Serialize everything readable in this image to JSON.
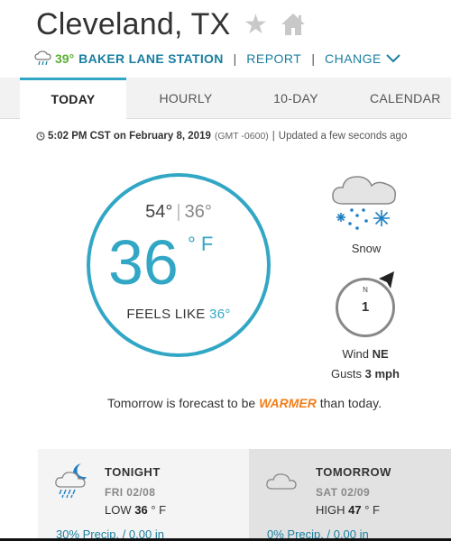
{
  "header": {
    "city": "Cleveland, TX",
    "station_temp": "39°",
    "station_name": "BAKER LANE STATION",
    "report_link": "REPORT",
    "change_link": "CHANGE"
  },
  "tabs": [
    {
      "label": "TODAY",
      "active": true
    },
    {
      "label": "HOURLY",
      "active": false
    },
    {
      "label": "10-DAY",
      "active": false
    },
    {
      "label": "CALENDAR",
      "active": false
    }
  ],
  "timestamp": {
    "time": "5:02 PM CST on February 8, 2019",
    "gmt": "(GMT -0600)",
    "separator": "|",
    "updated": "Updated a few seconds ago"
  },
  "current": {
    "high": "54°",
    "low": "36°",
    "temp": "36",
    "unit": "° F",
    "feels_like_label": "FEELS LIKE",
    "feels_like_value": "36°",
    "condition": "Snow",
    "wind_compass_label": "N",
    "wind_speed": "1",
    "wind_label": "Wind",
    "wind_dir": "NE",
    "gusts_label": "Gusts",
    "gusts_value": "3 mph"
  },
  "forecast_text": {
    "before": "Tomorrow is forecast to be ",
    "highlight": "WARMER",
    "after": " than today."
  },
  "cards": {
    "tonight": {
      "title": "TONIGHT",
      "date": "FRI 02/08",
      "temp_label": "LOW",
      "temp_value": "36",
      "temp_unit": "° F",
      "precip": "30% Precip. / 0.00 in"
    },
    "tomorrow": {
      "title": "TOMORROW",
      "date": "SAT 02/09",
      "temp_label": "HIGH",
      "temp_value": "47",
      "temp_unit": "° F",
      "precip": "0% Precip. / 0.00 in"
    }
  },
  "colors": {
    "accent": "#32a7c5",
    "link": "#1a7fa0",
    "station_temp": "#5ab035",
    "warm": "#f07f1d"
  },
  "icons": [
    "rain-icon",
    "star-icon",
    "home-icon",
    "chevron-down-icon",
    "clock-icon",
    "snow-icon",
    "wind-direction-icon",
    "night-rain-icon",
    "cloud-icon"
  ]
}
